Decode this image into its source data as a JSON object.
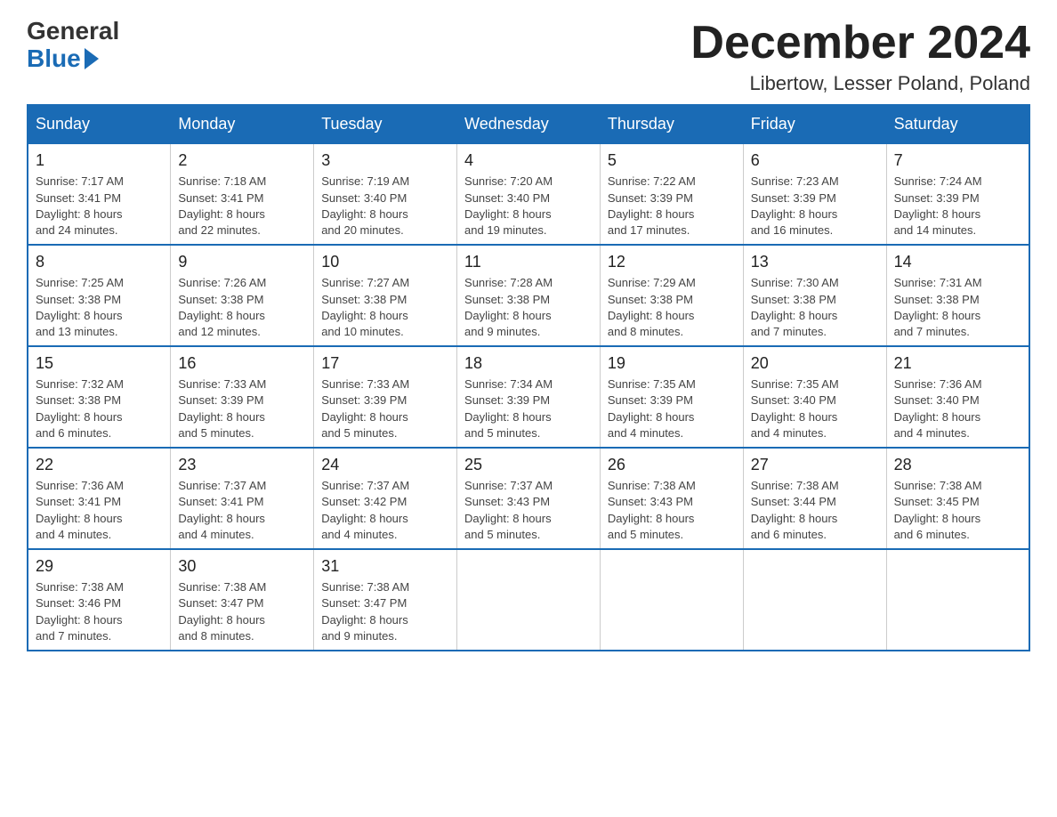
{
  "logo": {
    "text_general": "General",
    "text_blue": "Blue"
  },
  "header": {
    "month_title": "December 2024",
    "location": "Libertow, Lesser Poland, Poland"
  },
  "weekdays": [
    "Sunday",
    "Monday",
    "Tuesday",
    "Wednesday",
    "Thursday",
    "Friday",
    "Saturday"
  ],
  "weeks": [
    [
      {
        "day": "1",
        "sunrise": "7:17 AM",
        "sunset": "3:41 PM",
        "daylight": "8 hours and 24 minutes."
      },
      {
        "day": "2",
        "sunrise": "7:18 AM",
        "sunset": "3:41 PM",
        "daylight": "8 hours and 22 minutes."
      },
      {
        "day": "3",
        "sunrise": "7:19 AM",
        "sunset": "3:40 PM",
        "daylight": "8 hours and 20 minutes."
      },
      {
        "day": "4",
        "sunrise": "7:20 AM",
        "sunset": "3:40 PM",
        "daylight": "8 hours and 19 minutes."
      },
      {
        "day": "5",
        "sunrise": "7:22 AM",
        "sunset": "3:39 PM",
        "daylight": "8 hours and 17 minutes."
      },
      {
        "day": "6",
        "sunrise": "7:23 AM",
        "sunset": "3:39 PM",
        "daylight": "8 hours and 16 minutes."
      },
      {
        "day": "7",
        "sunrise": "7:24 AM",
        "sunset": "3:39 PM",
        "daylight": "8 hours and 14 minutes."
      }
    ],
    [
      {
        "day": "8",
        "sunrise": "7:25 AM",
        "sunset": "3:38 PM",
        "daylight": "8 hours and 13 minutes."
      },
      {
        "day": "9",
        "sunrise": "7:26 AM",
        "sunset": "3:38 PM",
        "daylight": "8 hours and 12 minutes."
      },
      {
        "day": "10",
        "sunrise": "7:27 AM",
        "sunset": "3:38 PM",
        "daylight": "8 hours and 10 minutes."
      },
      {
        "day": "11",
        "sunrise": "7:28 AM",
        "sunset": "3:38 PM",
        "daylight": "8 hours and 9 minutes."
      },
      {
        "day": "12",
        "sunrise": "7:29 AM",
        "sunset": "3:38 PM",
        "daylight": "8 hours and 8 minutes."
      },
      {
        "day": "13",
        "sunrise": "7:30 AM",
        "sunset": "3:38 PM",
        "daylight": "8 hours and 7 minutes."
      },
      {
        "day": "14",
        "sunrise": "7:31 AM",
        "sunset": "3:38 PM",
        "daylight": "8 hours and 7 minutes."
      }
    ],
    [
      {
        "day": "15",
        "sunrise": "7:32 AM",
        "sunset": "3:38 PM",
        "daylight": "8 hours and 6 minutes."
      },
      {
        "day": "16",
        "sunrise": "7:33 AM",
        "sunset": "3:39 PM",
        "daylight": "8 hours and 5 minutes."
      },
      {
        "day": "17",
        "sunrise": "7:33 AM",
        "sunset": "3:39 PM",
        "daylight": "8 hours and 5 minutes."
      },
      {
        "day": "18",
        "sunrise": "7:34 AM",
        "sunset": "3:39 PM",
        "daylight": "8 hours and 5 minutes."
      },
      {
        "day": "19",
        "sunrise": "7:35 AM",
        "sunset": "3:39 PM",
        "daylight": "8 hours and 4 minutes."
      },
      {
        "day": "20",
        "sunrise": "7:35 AM",
        "sunset": "3:40 PM",
        "daylight": "8 hours and 4 minutes."
      },
      {
        "day": "21",
        "sunrise": "7:36 AM",
        "sunset": "3:40 PM",
        "daylight": "8 hours and 4 minutes."
      }
    ],
    [
      {
        "day": "22",
        "sunrise": "7:36 AM",
        "sunset": "3:41 PM",
        "daylight": "8 hours and 4 minutes."
      },
      {
        "day": "23",
        "sunrise": "7:37 AM",
        "sunset": "3:41 PM",
        "daylight": "8 hours and 4 minutes."
      },
      {
        "day": "24",
        "sunrise": "7:37 AM",
        "sunset": "3:42 PM",
        "daylight": "8 hours and 4 minutes."
      },
      {
        "day": "25",
        "sunrise": "7:37 AM",
        "sunset": "3:43 PM",
        "daylight": "8 hours and 5 minutes."
      },
      {
        "day": "26",
        "sunrise": "7:38 AM",
        "sunset": "3:43 PM",
        "daylight": "8 hours and 5 minutes."
      },
      {
        "day": "27",
        "sunrise": "7:38 AM",
        "sunset": "3:44 PM",
        "daylight": "8 hours and 6 minutes."
      },
      {
        "day": "28",
        "sunrise": "7:38 AM",
        "sunset": "3:45 PM",
        "daylight": "8 hours and 6 minutes."
      }
    ],
    [
      {
        "day": "29",
        "sunrise": "7:38 AM",
        "sunset": "3:46 PM",
        "daylight": "8 hours and 7 minutes."
      },
      {
        "day": "30",
        "sunrise": "7:38 AM",
        "sunset": "3:47 PM",
        "daylight": "8 hours and 8 minutes."
      },
      {
        "day": "31",
        "sunrise": "7:38 AM",
        "sunset": "3:47 PM",
        "daylight": "8 hours and 9 minutes."
      },
      null,
      null,
      null,
      null
    ]
  ],
  "labels": {
    "sunrise": "Sunrise:",
    "sunset": "Sunset:",
    "daylight": "Daylight:"
  }
}
